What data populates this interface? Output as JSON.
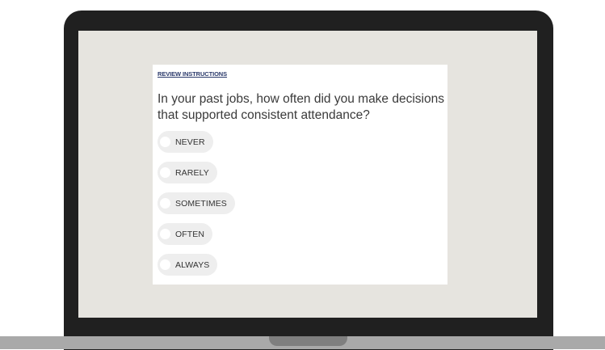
{
  "survey": {
    "review_link": "REVIEW INSTRUCTIONS",
    "question": "In your past jobs, how often did you make decisions that supported consistent attendance?",
    "options": [
      {
        "label": "NEVER"
      },
      {
        "label": "RARELY"
      },
      {
        "label": "SOMETIMES"
      },
      {
        "label": "OFTEN"
      },
      {
        "label": "ALWAYS"
      }
    ]
  },
  "colors": {
    "lid": "#202020",
    "screen_bg": "#e6e4df",
    "card_bg": "#ffffff",
    "link": "#2b3a6b",
    "option_bg": "#eeeeee",
    "base": "#a9a9a9"
  }
}
